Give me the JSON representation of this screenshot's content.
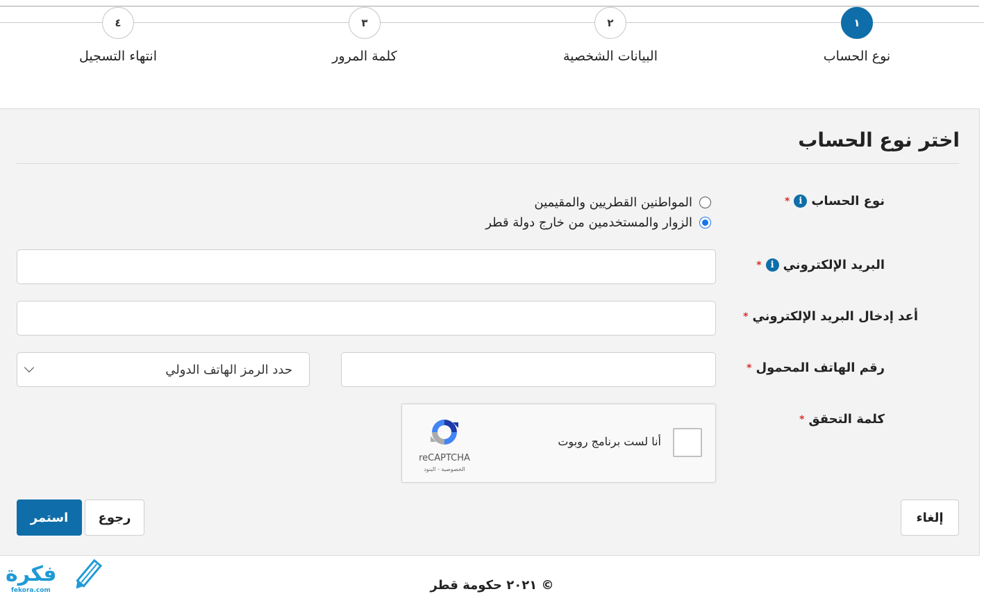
{
  "stepper": {
    "steps": [
      {
        "number": "١",
        "label": "نوع الحساب"
      },
      {
        "number": "٢",
        "label": "البيانات الشخصية"
      },
      {
        "number": "٣",
        "label": "كلمة المرور"
      },
      {
        "number": "٤",
        "label": "انتهاء التسجيل"
      }
    ],
    "active_step": 1
  },
  "form": {
    "title": "اختر نوع الحساب",
    "account_type": {
      "label": "نوع الحساب",
      "required_mark": "*",
      "info_icon": "i",
      "options": [
        {
          "label": "المواطنين القطريين والمقيمين",
          "selected": false
        },
        {
          "label": "الزوار والمستخدمين من خارج دولة قطر",
          "selected": true
        }
      ]
    },
    "email": {
      "label": "البريد الإلكتروني",
      "required_mark": "*",
      "info_icon": "i",
      "value": ""
    },
    "email_confirm": {
      "label": "أعد إدخال البريد الإلكتروني",
      "required_mark": "*",
      "value": ""
    },
    "mobile": {
      "label": "رقم الهاتف المحمول",
      "required_mark": "*",
      "value": "",
      "country_code_select": "حدد الرمز الهاتف الدولي"
    },
    "captcha": {
      "label": "كلمة التحقق",
      "required_mark": "*",
      "checkbox_text": "أنا لست برنامج روبوت",
      "brand": "reCAPTCHA",
      "links": "الخصوصية - البنود"
    }
  },
  "buttons": {
    "continue": "استمر",
    "back": "رجوع",
    "cancel": "إلغاء"
  },
  "footer": {
    "copyright": "© ٢٠٢١ حكومة قطر",
    "logo_text": "فكرة",
    "logo_sub": "fekora.com"
  },
  "colors": {
    "primary": "#0f6ea9",
    "radio_selected": "#1a73e8",
    "required": "#d9312b",
    "logo": "#1f9ad6"
  }
}
